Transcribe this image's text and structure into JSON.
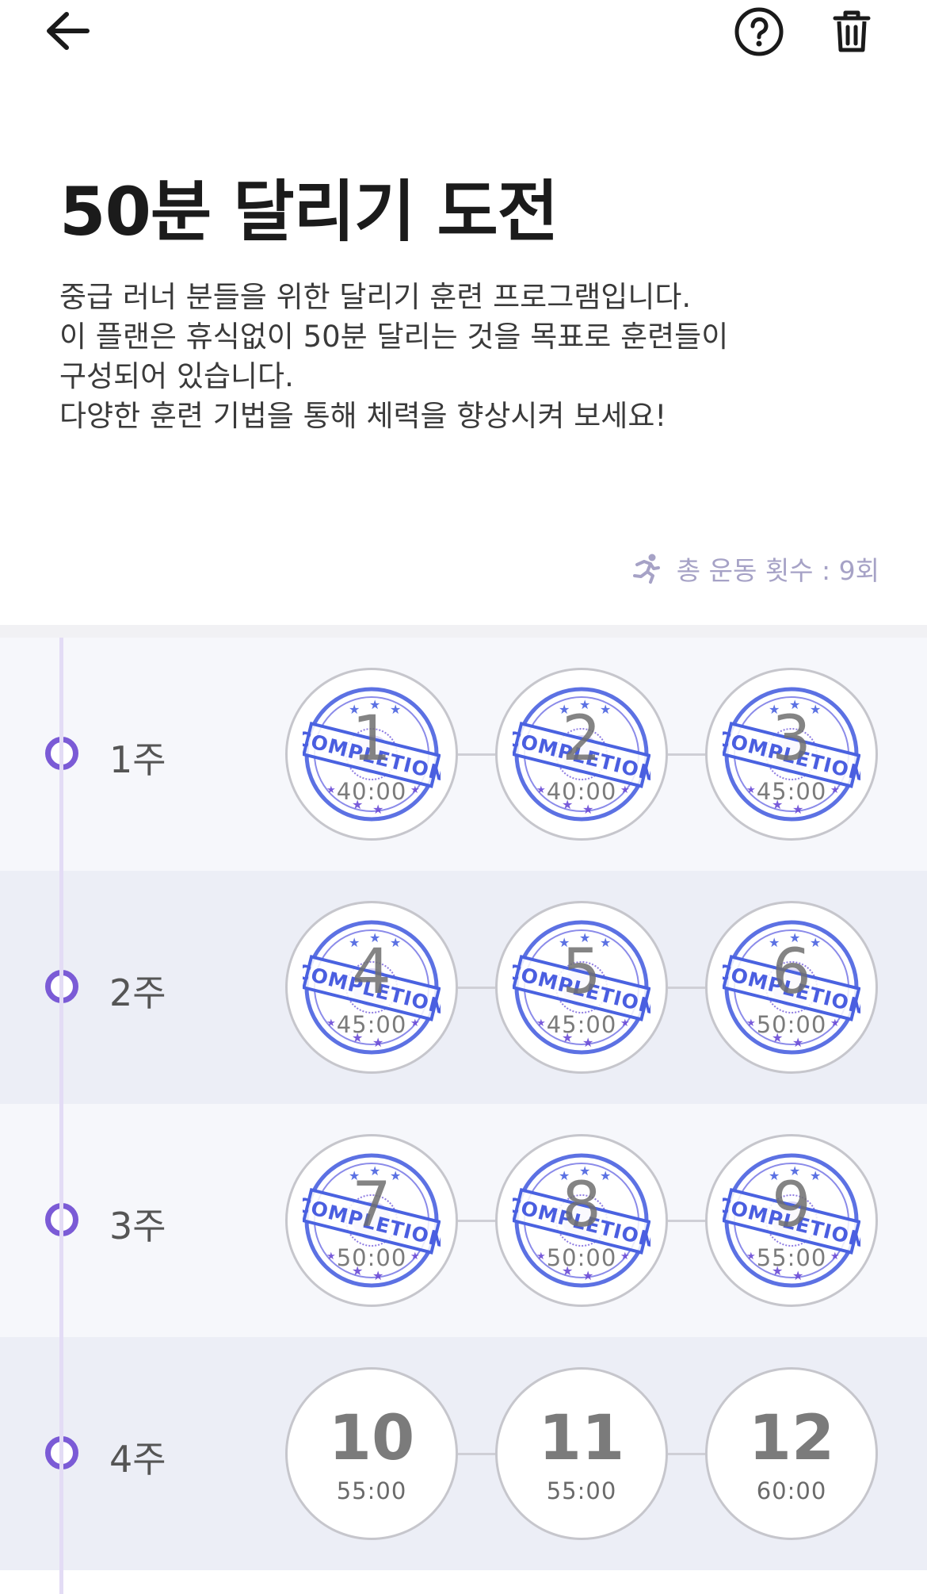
{
  "header": {
    "back_icon": "arrow-left-icon",
    "help_icon": "question-circle-icon",
    "delete_icon": "trash-icon"
  },
  "plan": {
    "title": "50분 달리기 도전",
    "description": [
      "중급 러너 분들을 위한 달리기 훈련 프로그램입니다.",
      "이 플랜은 휴식없이 50분 달리는 것을 목표로 훈련들이",
      "구성되어 있습니다.",
      "다양한 훈련 기법을 통해 체력을 향상시켜 보세요!"
    ],
    "total_label": "총 운동 횟수 : 9회",
    "total_icon": "runner-icon"
  },
  "colors": {
    "accent": "#7b5bd6",
    "stamp": "#4a62e0",
    "muted": "#a6a2c6"
  },
  "stamp_text": "COMPLETION",
  "weeks": [
    {
      "label": "1주",
      "sessions": [
        {
          "number": "1",
          "time": "40:00",
          "completed": true
        },
        {
          "number": "2",
          "time": "40:00",
          "completed": true
        },
        {
          "number": "3",
          "time": "45:00",
          "completed": true
        }
      ]
    },
    {
      "label": "2주",
      "sessions": [
        {
          "number": "4",
          "time": "45:00",
          "completed": true
        },
        {
          "number": "5",
          "time": "45:00",
          "completed": true
        },
        {
          "number": "6",
          "time": "50:00",
          "completed": true
        }
      ]
    },
    {
      "label": "3주",
      "sessions": [
        {
          "number": "7",
          "time": "50:00",
          "completed": true
        },
        {
          "number": "8",
          "time": "50:00",
          "completed": true
        },
        {
          "number": "9",
          "time": "55:00",
          "completed": true
        }
      ]
    },
    {
      "label": "4주",
      "sessions": [
        {
          "number": "10",
          "time": "55:00",
          "completed": false
        },
        {
          "number": "11",
          "time": "55:00",
          "completed": false
        },
        {
          "number": "12",
          "time": "60:00",
          "completed": false
        }
      ]
    }
  ]
}
